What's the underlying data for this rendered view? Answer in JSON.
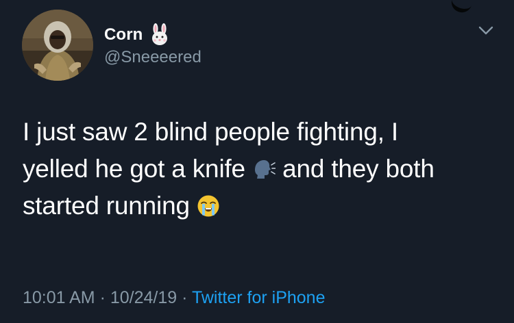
{
  "tweet": {
    "display_name": "Corn",
    "handle": "@Sneeeered",
    "text_line1": "I just saw 2 blind people fighting, I",
    "text_line2_part1": "yelled he got a knife",
    "text_line2_part2": "and they both",
    "text_line3": "started running",
    "time": "10:01 AM",
    "separator": " · ",
    "date": "10/24/19",
    "source": "Twitter for iPhone"
  },
  "icons": {
    "name_badge": "rabbit-face-icon",
    "emoji_speaking": "speaking-head-icon",
    "emoji_crying": "loudly-crying-face-icon",
    "menu": "chevron-down-icon"
  },
  "colors": {
    "background": "#161d28",
    "text": "#ffffff",
    "secondary": "#8899a6",
    "link": "#1da1f2"
  }
}
